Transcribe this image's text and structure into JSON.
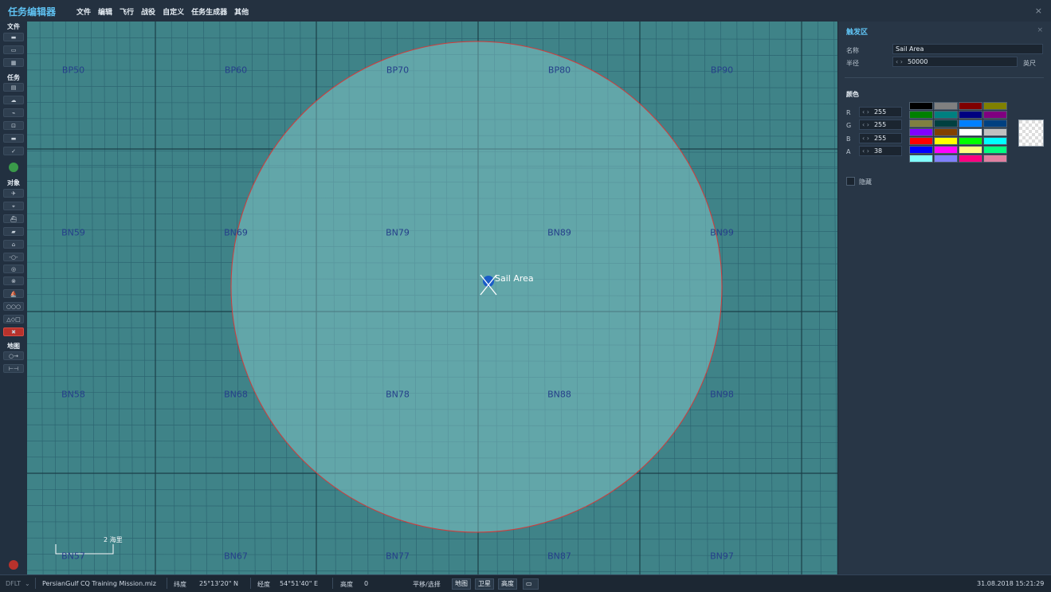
{
  "app": {
    "title": "任务编辑器",
    "menu": [
      "文件",
      "编辑",
      "飞行",
      "战役",
      "自定义",
      "任务生成器",
      "其他"
    ],
    "close_glyph": "×"
  },
  "toolbar": {
    "sections": {
      "file": "文件",
      "mission": "任务",
      "objects": "对象",
      "map": "地图"
    }
  },
  "map": {
    "grid_labels": [
      "BP50",
      "BP60",
      "BP70",
      "BP80",
      "BP90",
      "BN59",
      "BN69",
      "BN79",
      "BN89",
      "BN99",
      "BN58",
      "BN68",
      "BN78",
      "BN88",
      "BN98",
      "BN57",
      "BN67",
      "BN77",
      "BN87",
      "BN97"
    ],
    "trigger_name": "Sail Area",
    "scale_text": "2 海里"
  },
  "panel": {
    "title": "触发区",
    "close_glyph": "×",
    "name_label": "名称",
    "name_value": "Sail Area",
    "radius_label": "半径",
    "radius_value": "50000",
    "radius_unit": "英尺",
    "color_title": "颜色",
    "r_label": "R",
    "r_value": "255",
    "g_label": "G",
    "g_value": "255",
    "b_label": "B",
    "b_value": "255",
    "a_label": "A",
    "a_value": "38",
    "hide_label": "隐藏",
    "swatches": [
      "#000000",
      "#808080",
      "#800000",
      "#808000",
      "#008000",
      "#008080",
      "#000080",
      "#800080",
      "#808040",
      "#004040",
      "#0080ff",
      "#004080",
      "#8000ff",
      "#804000",
      "#ffffff",
      "#c0c0c0",
      "#ff0000",
      "#ffff00",
      "#00ff00",
      "#00ffff",
      "#0000ff",
      "#ff00ff",
      "#ffff80",
      "#00ff80",
      "#80ffff",
      "#8080ff",
      "#ff0080",
      "#e080a0"
    ]
  },
  "status": {
    "mode": "DFLT",
    "file": "PersianGulf CQ Training Mission.miz",
    "lat_label": "纬度",
    "lat_value": "25°13'20\" N",
    "lon_label": "经度",
    "lon_value": "54°51'40\" E",
    "alt_label": "高度",
    "alt_value": "0",
    "pan_select": "平移/选择",
    "btn_map": "地图",
    "btn_satellite": "卫星",
    "btn_altitude": "高度",
    "datetime": "31.08.2018 15:21:29"
  },
  "colors": {
    "accent": "#5fc2f2",
    "map_sea": "#3f8388",
    "zone_border": "#d23a3a",
    "grid_label": "#253f8a"
  }
}
